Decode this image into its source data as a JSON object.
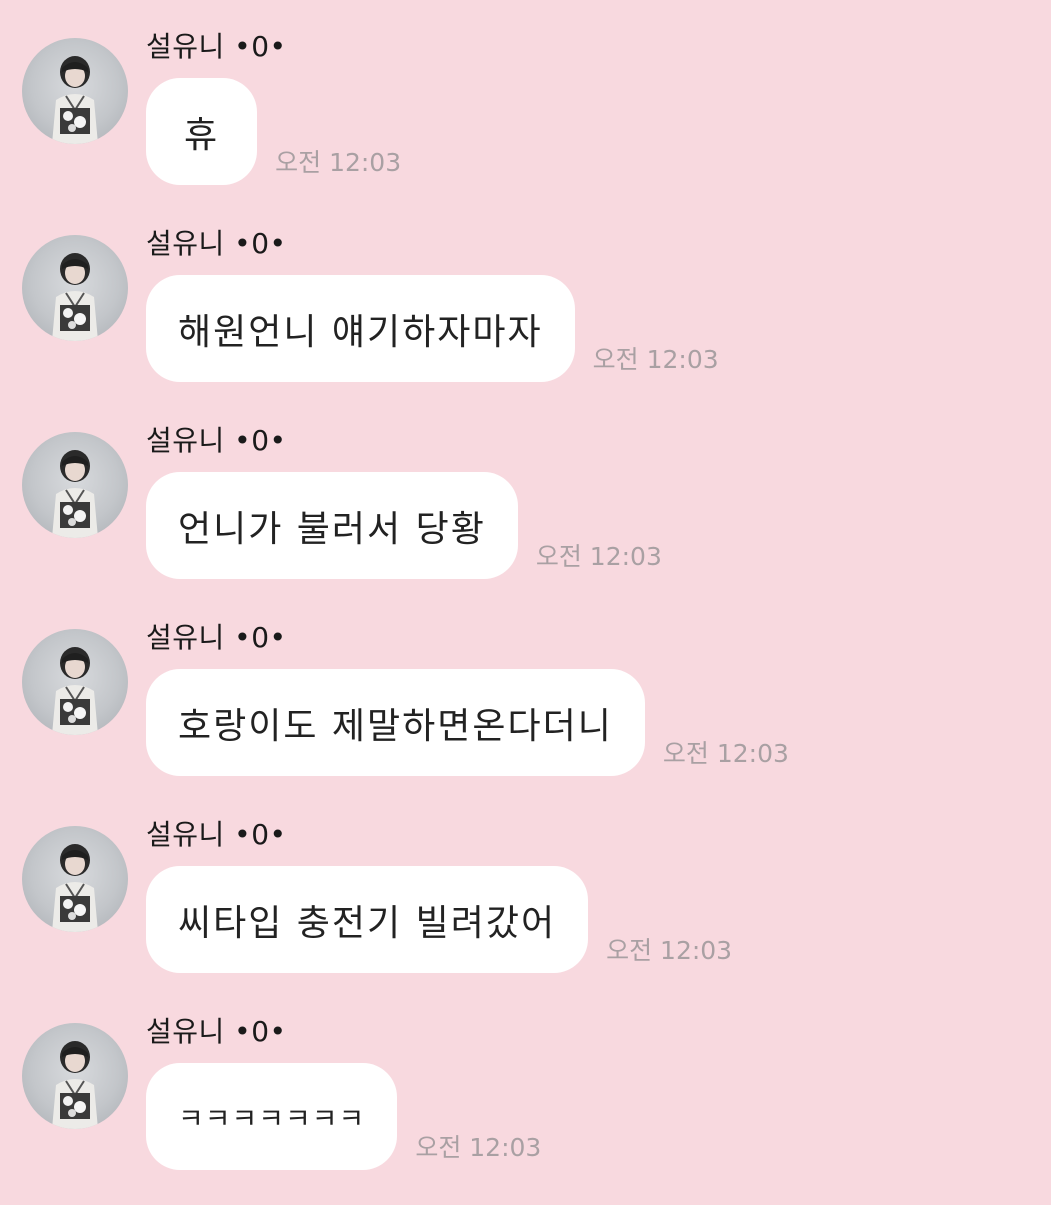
{
  "chat": {
    "messages": [
      {
        "sender": "설유니 •0•",
        "text": "휴",
        "time": "오전 12:03"
      },
      {
        "sender": "설유니 •0•",
        "text": "해원언니 얘기하자마자",
        "time": "오전 12:03"
      },
      {
        "sender": "설유니 •0•",
        "text": "언니가 불러서 당황",
        "time": "오전 12:03"
      },
      {
        "sender": "설유니 •0•",
        "text": "호랑이도 제말하면온다더니",
        "time": "오전 12:03"
      },
      {
        "sender": "설유니 •0•",
        "text": "씨타입 충전기 빌려갔어",
        "time": "오전 12:03"
      },
      {
        "sender": "설유니 •0•",
        "text": "ㅋㅋㅋㅋㅋㅋㅋ",
        "time": "오전 12:03"
      }
    ]
  },
  "colors": {
    "background": "#f8d9df",
    "bubble": "#ffffff",
    "timestamp": "#a9a0a3"
  },
  "icons": {
    "avatar": "profile-photo"
  }
}
